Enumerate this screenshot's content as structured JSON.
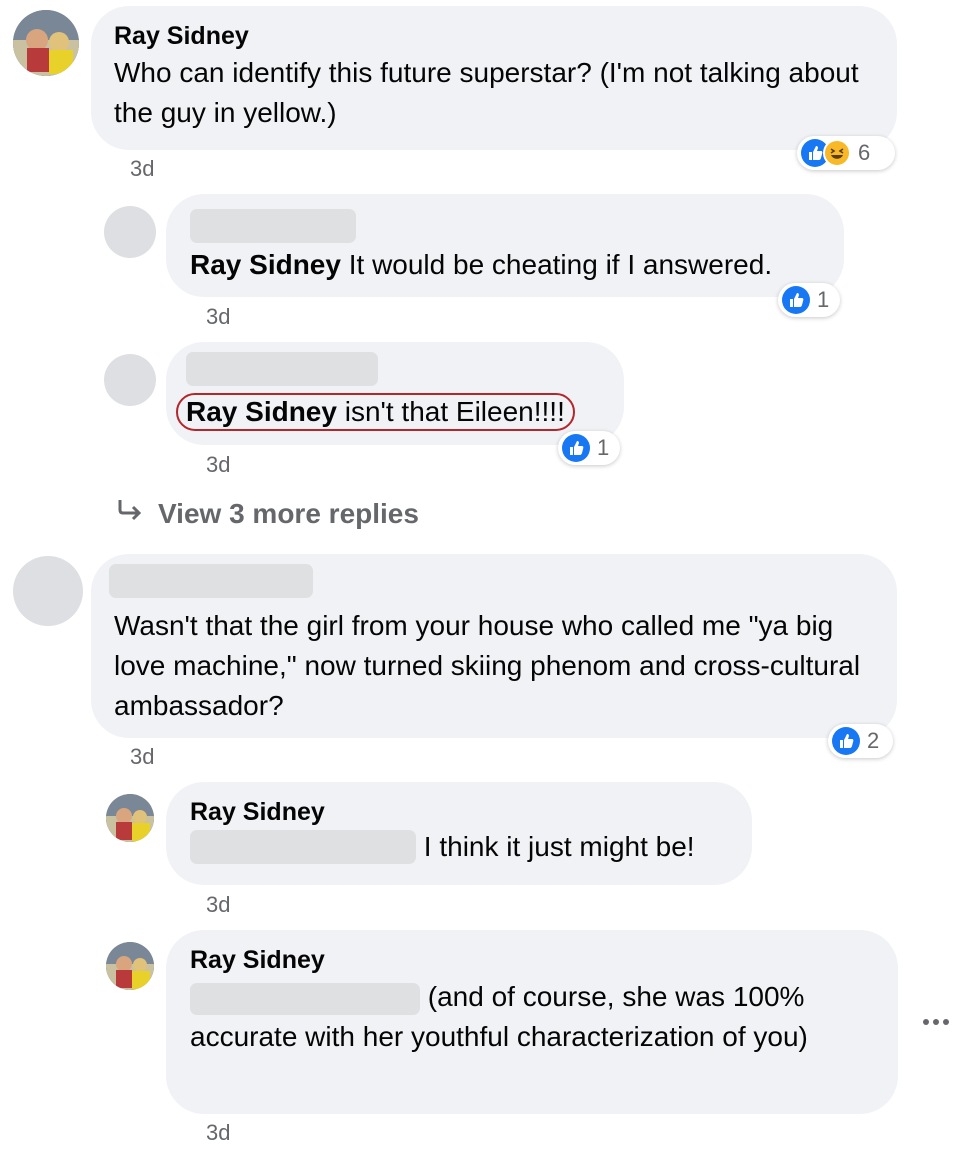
{
  "comments": [
    {
      "author": "Ray Sidney",
      "text": "Who can identify this future superstar? (I'm not talking about the guy in yellow.)",
      "time": "3d",
      "reaction_count": "6",
      "reactions": [
        "like-icon",
        "haha-icon"
      ]
    },
    {
      "author": "",
      "mention": "Ray Sidney",
      "text": " It would be cheating if I answered.",
      "time": "3d",
      "reaction_count": "1",
      "reactions": [
        "like-icon"
      ]
    },
    {
      "author": "",
      "mention": "Ray Sidney",
      "text": " isn't that Eileen!!!!",
      "time": "3d",
      "reaction_count": "1",
      "reactions": [
        "like-icon"
      ],
      "highlight_color": "#b3262c"
    },
    {
      "view_more": "View 3 more replies"
    },
    {
      "author": "",
      "text": "Wasn't that the girl from your house who called me \"ya big love machine,\" now turned skiing phenom and cross-cultural ambassador?",
      "time": "3d",
      "reaction_count": "2",
      "reactions": [
        "like-icon"
      ]
    },
    {
      "author": "Ray Sidney",
      "text": " I think it just might be!",
      "time": "3d"
    },
    {
      "author": "Ray Sidney",
      "text": " (and of course, she was 100% accurate with her youthful characterization of you)",
      "time": "3d"
    }
  ],
  "more_icon": "more-options-icon",
  "colors": {
    "bubble": "#f0f2f5",
    "like_blue": "#1877f2",
    "secondary_text": "#65676b",
    "haha_yellow": "#f7b928"
  }
}
